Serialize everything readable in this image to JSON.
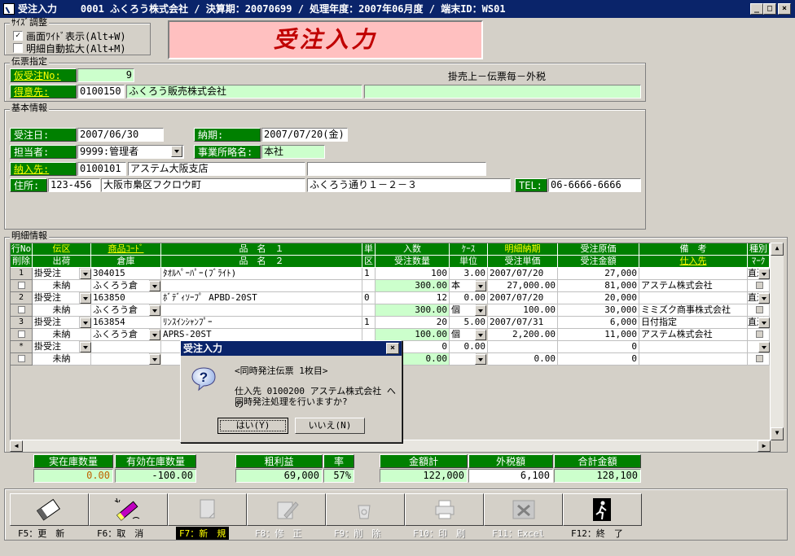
{
  "window": {
    "title": "受注入力    0001 ふくろう株式会社 / 決算期：20070699 / 処理年度：2007年06月度 / 端末ID：WS01",
    "min": "_",
    "max": "□",
    "close": "×"
  },
  "size_group": {
    "title": "ｻｲｽﾞ調整",
    "opt1": "画面ﾜｲﾄﾞ表示(Alt+W)",
    "opt1_checked": "✓",
    "opt2": "明細自動拡大(Alt+M)"
  },
  "banner": "受注入力",
  "slip": {
    "title": "伝票指定",
    "karijuchu_label": "仮受注No:",
    "karijuchu_value": "9",
    "tokui_label": "得意先:",
    "tokui_code": "0100150",
    "tokui_name": "ふくろう販売株式会社",
    "tokui_extra": "",
    "terms": "掛売上－伝票毎－外税"
  },
  "basic": {
    "title": "基本情報",
    "juchu_label": "受注日:",
    "juchu_value": "2007/06/30",
    "noki_label": "納期:",
    "noki_value": "2007/07/20(金)",
    "tanto_label": "担当者:",
    "tanto_value": "9999:管理者",
    "jigyo_label": "事業所略名:",
    "jigyo_value": "本社",
    "nonyu_label": "納入先:",
    "nonyu_code": "0100101",
    "nonyu_name": "アステム大阪支店",
    "nonyu_extra": "",
    "addr_label": "住所:",
    "zip": "123-456",
    "addr1": "大阪市梟区フクロウ町",
    "addr2": "ふくろう通り１－２－３",
    "tel_label": "TEL:",
    "tel_value": "06-6666-6666"
  },
  "detail": {
    "title": "明細情報",
    "h1": [
      "行No",
      "伝区",
      "商品ｺｰﾄﾞ",
      "品　名　１",
      "単",
      "入数",
      "ｹｰｽ",
      "明細納期",
      "受注原価",
      "備　考",
      "種別"
    ],
    "h2": [
      "削除",
      "出荷",
      "倉庫",
      "品　名　２",
      "区",
      "受注数量",
      "単位",
      "受注単価",
      "受注金額",
      "仕入先",
      "ﾏｰｸ"
    ],
    "rows": [
      {
        "no": "1",
        "denku": "掛受注",
        "code": "304015",
        "name1": "ﾀｵﾙﾍﾟｰﾊﾟｰ(ﾌﾞﾗｲﾄ)",
        "tan": "1",
        "irisu": "100",
        "case": "3.00",
        "noki": "2007/07/20",
        "genka": "27,000",
        "biko": "",
        "shubetsu": "直送",
        "shukka": "未納",
        "soko": "ふくろう倉",
        "name2": "",
        "ku": "",
        "qty": "300.00",
        "unit": "本",
        "price": "27,000.00",
        "amount": "81,000",
        "shiire": "アステム株式会社"
      },
      {
        "no": "2",
        "denku": "掛受注",
        "code": "163850",
        "name1": "ﾎﾞﾃﾞｨｿｰﾌﾟ APBD-20ST",
        "tan": "0",
        "irisu": "12",
        "case": "0.00",
        "noki": "2007/07/20",
        "genka": "20,000",
        "biko": "",
        "shubetsu": "直送",
        "shukka": "未納",
        "soko": "ふくろう倉",
        "name2": "",
        "ku": "",
        "qty": "300.00",
        "unit": "個",
        "price": "100.00",
        "amount": "30,000",
        "shiire": "ミミズク商事株式会社"
      },
      {
        "no": "3",
        "denku": "掛受注",
        "code": "163854",
        "name1": "ﾘﾝｽｲﾝｼｬﾝﾌﾟｰ",
        "tan": "1",
        "irisu": "20",
        "case": "5.00",
        "noki": "2007/07/31",
        "genka": "6,000",
        "biko": "日付指定",
        "shubetsu": "直送",
        "shukka": "未納",
        "soko": "ふくろう倉",
        "name2": "APRS-20ST",
        "ku": "",
        "qty": "100.00",
        "unit": "個",
        "price": "2,200.00",
        "amount": "11,000",
        "shiire": "アステム株式会社"
      },
      {
        "no": "*",
        "denku": "掛受注",
        "code": "",
        "name1": "",
        "tan": "",
        "irisu": "0",
        "case": "0.00",
        "noki": "",
        "genka": "0",
        "biko": "",
        "shubetsu": "",
        "shukka": "未納",
        "soko": "",
        "name2": "",
        "ku": "",
        "qty": "0.00",
        "unit": "",
        "price": "0.00",
        "amount": "0",
        "shiire": ""
      }
    ]
  },
  "summary": {
    "jitsu_label": "実在庫数量",
    "jitsu_value": "0.00",
    "yuko_label": "有効在庫数量",
    "yuko_value": "-100.00",
    "arari_label": "粗利益",
    "arari_value": "69,000",
    "ritsu_label": "率",
    "ritsu_value": "57%",
    "kingaku_label": "金額計",
    "kingaku_value": "122,000",
    "zei_label": "外税額",
    "zei_value": "6,100",
    "gokei_label": "合計金額",
    "gokei_value": "128,100"
  },
  "fkeys": [
    "F5：更　新",
    "F6：取　消",
    "F7：新　規",
    "F8：修　正",
    "F9：削　除",
    "F10：印　刷",
    "F11：Excel",
    "F12：終　了"
  ],
  "dialog": {
    "title": "受注入力",
    "line1": "<同時発注伝票 1枚目>",
    "line2": "仕入先 0100200 アステム株式会社 への",
    "line3": "同時発注処理を行いますか?",
    "yes": "はい(Y)",
    "no": "いいえ(N)",
    "icon": "?"
  },
  "colors": {
    "accent_green": "#008000",
    "field_green": "#ccffcc",
    "title_blue": "#0a246a",
    "banner_pink": "#ffc0c0",
    "banner_red": "#c00000"
  }
}
